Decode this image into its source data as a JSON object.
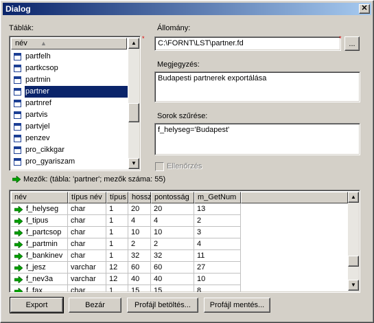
{
  "window": {
    "title": "Dialog",
    "close_glyph": "✕"
  },
  "tables": {
    "label": "Táblák:",
    "column": "név",
    "items": [
      "partfelh",
      "partkcsop",
      "partmin",
      "partner",
      "partnref",
      "partvis",
      "partvjel",
      "penzev",
      "pro_cikkgar",
      "pro_gyariszam"
    ],
    "selected": "partner"
  },
  "file": {
    "label": "Állomány:",
    "value": "C:\\FORNT\\LST\\partner.fd",
    "browse": "..."
  },
  "note": {
    "label": "Megjegyzés:",
    "value": "Budapesti partnerek exportálása"
  },
  "filter": {
    "label": "Sorok szűrése:",
    "value": "f_helyseg='Budapest'"
  },
  "check": {
    "label": "Ellenőrzés",
    "checked": false
  },
  "fields": {
    "label": "Mezők: (tábla: 'partner'; mezők száma: 55)",
    "columns": [
      "név",
      "típus név",
      "típus",
      "hossz",
      "pontosság",
      "m_GetNum"
    ],
    "rows": [
      [
        "f_helyseg",
        "char",
        "1",
        "20",
        "20",
        "13"
      ],
      [
        "f_tipus",
        "char",
        "1",
        "4",
        "4",
        "2"
      ],
      [
        "f_partcsop",
        "char",
        "1",
        "10",
        "10",
        "3"
      ],
      [
        "f_partmin",
        "char",
        "1",
        "2",
        "2",
        "4"
      ],
      [
        "f_bankinev",
        "char",
        "1",
        "32",
        "32",
        "11"
      ],
      [
        "f_jesz",
        "varchar",
        "12",
        "60",
        "60",
        "27"
      ],
      [
        "f_nev3a",
        "varchar",
        "12",
        "40",
        "40",
        "10"
      ],
      [
        "f_fax",
        "char",
        "1",
        "15",
        "15",
        "8"
      ]
    ]
  },
  "buttons": {
    "export": "Export",
    "close": "Bezár",
    "load_profile": "Profájl betöltés...",
    "save_profile": "Profájl mentés..."
  }
}
